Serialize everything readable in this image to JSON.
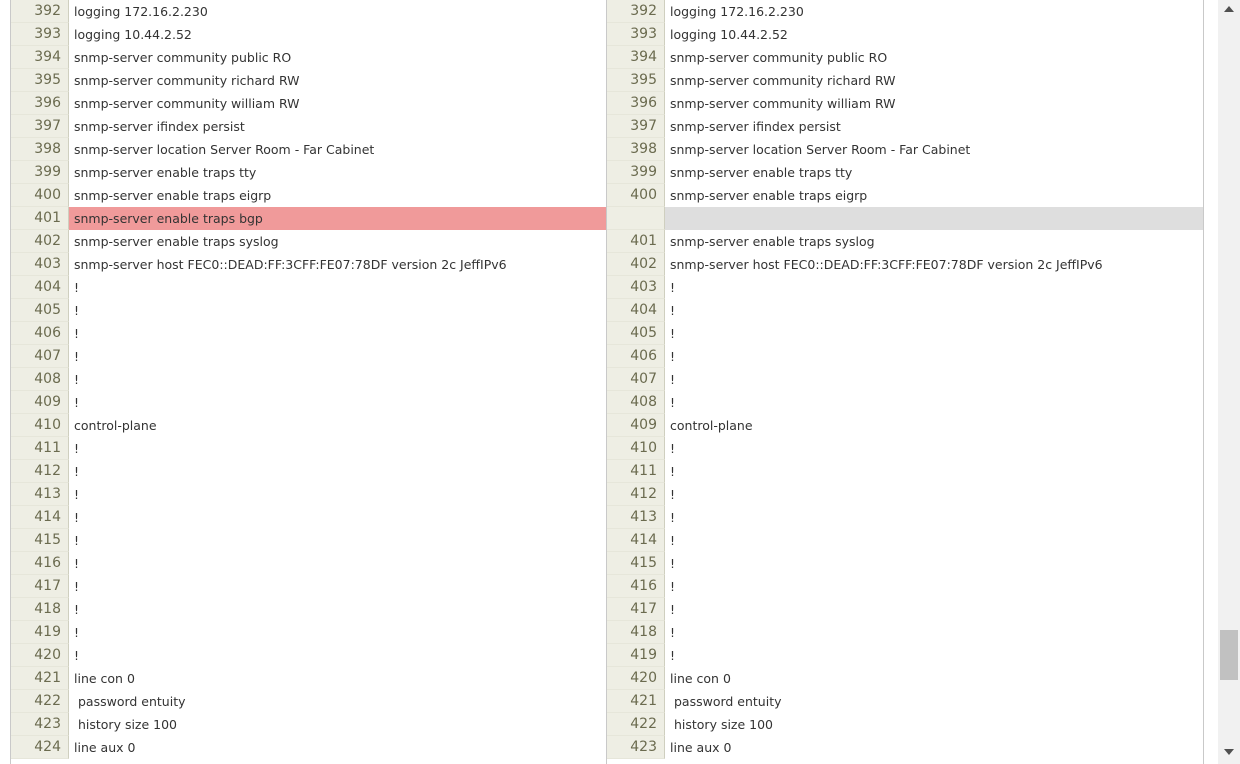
{
  "left_pane": {
    "rows": [
      {
        "num": "392",
        "text": "logging 172.16.2.230"
      },
      {
        "num": "393",
        "text": "logging 10.44.2.52"
      },
      {
        "num": "394",
        "text": "snmp-server community public RO"
      },
      {
        "num": "395",
        "text": "snmp-server community richard RW"
      },
      {
        "num": "396",
        "text": "snmp-server community william RW"
      },
      {
        "num": "397",
        "text": "snmp-server ifindex persist"
      },
      {
        "num": "398",
        "text": "snmp-server location Server Room - Far Cabinet"
      },
      {
        "num": "399",
        "text": "snmp-server enable traps tty"
      },
      {
        "num": "400",
        "text": "snmp-server enable traps eigrp"
      },
      {
        "num": "401",
        "text": "snmp-server enable traps bgp",
        "status": "removed"
      },
      {
        "num": "402",
        "text": "snmp-server enable traps syslog"
      },
      {
        "num": "403",
        "text": "snmp-server host FEC0::DEAD:FF:3CFF:FE07:78DF version 2c JeffIPv6"
      },
      {
        "num": "404",
        "text": "!"
      },
      {
        "num": "405",
        "text": "!"
      },
      {
        "num": "406",
        "text": "!"
      },
      {
        "num": "407",
        "text": "!"
      },
      {
        "num": "408",
        "text": "!"
      },
      {
        "num": "409",
        "text": "!"
      },
      {
        "num": "410",
        "text": "control-plane"
      },
      {
        "num": "411",
        "text": "!"
      },
      {
        "num": "412",
        "text": "!"
      },
      {
        "num": "413",
        "text": "!"
      },
      {
        "num": "414",
        "text": "!"
      },
      {
        "num": "415",
        "text": "!"
      },
      {
        "num": "416",
        "text": "!"
      },
      {
        "num": "417",
        "text": "!"
      },
      {
        "num": "418",
        "text": "!"
      },
      {
        "num": "419",
        "text": "!"
      },
      {
        "num": "420",
        "text": "!"
      },
      {
        "num": "421",
        "text": "line con 0"
      },
      {
        "num": "422",
        "text": " password entuity"
      },
      {
        "num": "423",
        "text": " history size 100"
      },
      {
        "num": "424",
        "text": "line aux 0"
      }
    ]
  },
  "right_pane": {
    "rows": [
      {
        "num": "392",
        "text": "logging 172.16.2.230"
      },
      {
        "num": "393",
        "text": "logging 10.44.2.52"
      },
      {
        "num": "394",
        "text": "snmp-server community public RO"
      },
      {
        "num": "395",
        "text": "snmp-server community richard RW"
      },
      {
        "num": "396",
        "text": "snmp-server community william RW"
      },
      {
        "num": "397",
        "text": "snmp-server ifindex persist"
      },
      {
        "num": "398",
        "text": "snmp-server location Server Room - Far Cabinet"
      },
      {
        "num": "399",
        "text": "snmp-server enable traps tty"
      },
      {
        "num": "400",
        "text": "snmp-server enable traps eigrp"
      },
      {
        "num": "",
        "text": "",
        "status": "placeholder"
      },
      {
        "num": "401",
        "text": "snmp-server enable traps syslog"
      },
      {
        "num": "402",
        "text": "snmp-server host FEC0::DEAD:FF:3CFF:FE07:78DF version 2c JeffIPv6"
      },
      {
        "num": "403",
        "text": "!"
      },
      {
        "num": "404",
        "text": "!"
      },
      {
        "num": "405",
        "text": "!"
      },
      {
        "num": "406",
        "text": "!"
      },
      {
        "num": "407",
        "text": "!"
      },
      {
        "num": "408",
        "text": "!"
      },
      {
        "num": "409",
        "text": "control-plane"
      },
      {
        "num": "410",
        "text": "!"
      },
      {
        "num": "411",
        "text": "!"
      },
      {
        "num": "412",
        "text": "!"
      },
      {
        "num": "413",
        "text": "!"
      },
      {
        "num": "414",
        "text": "!"
      },
      {
        "num": "415",
        "text": "!"
      },
      {
        "num": "416",
        "text": "!"
      },
      {
        "num": "417",
        "text": "!"
      },
      {
        "num": "418",
        "text": "!"
      },
      {
        "num": "419",
        "text": "!"
      },
      {
        "num": "420",
        "text": "line con 0"
      },
      {
        "num": "421",
        "text": " password entuity"
      },
      {
        "num": "422",
        "text": " history size 100"
      },
      {
        "num": "423",
        "text": "line aux 0"
      }
    ]
  },
  "colors": {
    "removed_line": "#f09a9a",
    "placeholder_line": "#dedede",
    "gutter_bg": "#eeeee4",
    "gutter_text": "#6b6b4f"
  },
  "icons": {
    "scroll_up": "triangle-up-icon",
    "scroll_down": "triangle-down-icon"
  }
}
